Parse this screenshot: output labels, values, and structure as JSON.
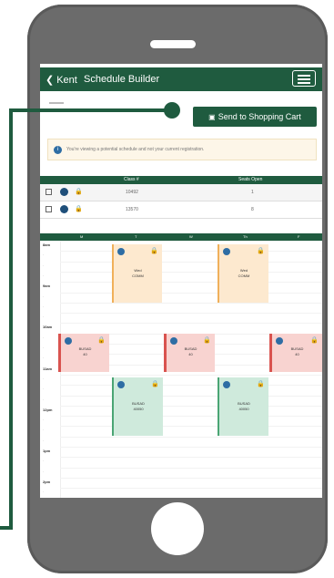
{
  "header": {
    "back_label": "Kent",
    "title": "Schedule Builder"
  },
  "actions": {
    "send_label": "Send to Shopping Cart"
  },
  "info": {
    "text": "You're viewing a potential schedule and not your current registration."
  },
  "course_table": {
    "headers": [
      "",
      "Class #",
      "Seats Open"
    ],
    "rows": [
      {
        "class_no": "10492",
        "seats": "1"
      },
      {
        "class_no": "13570",
        "seats": "8"
      }
    ]
  },
  "calendar": {
    "days": [
      "M",
      "T",
      "W",
      "Th",
      "F"
    ],
    "times": [
      "8am",
      "",
      "",
      "",
      "9am",
      "",
      "",
      "",
      "10am",
      "",
      "",
      "",
      "11am",
      "",
      "",
      "",
      "12pm",
      "",
      "",
      "",
      "1pm",
      "",
      "",
      "2pm",
      ""
    ],
    "events": [
      {
        "color": "orange",
        "label": "Wed\nCOMM"
      },
      {
        "color": "orange",
        "label": "Wed\nCOMM"
      },
      {
        "color": "red",
        "label": "BUSAD\n40"
      },
      {
        "color": "red",
        "label": "BUSAD\n40"
      },
      {
        "color": "red",
        "label": "BUSAD\n40"
      },
      {
        "color": "green",
        "label": "BUSAD\n40050"
      },
      {
        "color": "green",
        "label": "BUSAD\n40050"
      }
    ]
  },
  "colors": {
    "brand": "#1f5b3f",
    "info_bg": "#fdf6e8",
    "event_orange": "#fde9cf",
    "event_red": "#f8d3d0",
    "event_green": "#cfeadc"
  },
  "icons": [
    "chevron-left-icon",
    "menu-icon",
    "cart-icon",
    "info-icon",
    "lock-icon",
    "checkbox-icon"
  ]
}
